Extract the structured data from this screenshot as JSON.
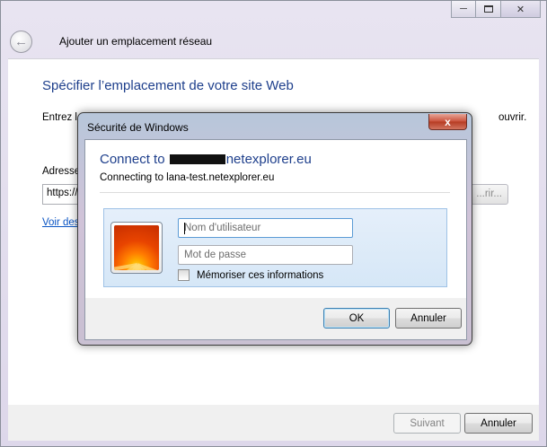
{
  "window": {
    "title": "Ajouter un emplacement réseau",
    "heading": "Spécifier l’emplacement de votre site Web",
    "intro_visible_start": "Entrez l",
    "intro_visible_end": "ouvrir.",
    "address_label": "Adresse",
    "address_value": "https://",
    "browse_label": "...rir...",
    "examples_link": "Voir des",
    "next_label": "Suivant",
    "cancel_label": "Annuler"
  },
  "dialog": {
    "title": "Sécurité de Windows",
    "close_label": "x",
    "heading_prefix": "Connect to ",
    "heading_suffix": "netexplorer.eu",
    "connecting_text": "Connecting to lana-test.netexplorer.eu",
    "username_placeholder": "Nom d'utilisateur",
    "password_placeholder": "Mot de passe",
    "remember_label": "Mémoriser ces informations",
    "remember_checked": false,
    "ok_label": "OK",
    "cancel_label": "Annuler"
  },
  "colors": {
    "heading_blue": "#1e3f8c",
    "link_blue": "#0b55c4",
    "close_red": "#c9503a",
    "tile_bg": "#dbe9f7"
  },
  "icons": [
    "back-arrow-icon",
    "minimize-icon",
    "maximize-icon",
    "close-icon",
    "user-avatar-flower-icon",
    "checkbox-icon"
  ]
}
